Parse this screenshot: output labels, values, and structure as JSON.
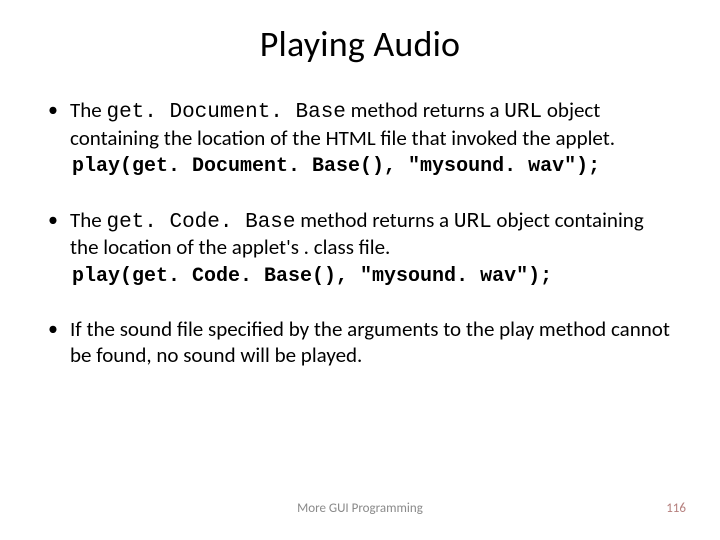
{
  "title": "Playing Audio",
  "bullets": [
    {
      "pre": "The ",
      "code1": "get. Document. Base",
      "mid1": " method returns a ",
      "code2": "URL",
      "post": " object containing the location of the HTML file that invoked the applet.",
      "codeline": "play(get. Document. Base(), \"mysound. wav\");"
    },
    {
      "pre": "The ",
      "code1": "get. Code. Base",
      "mid1": " method returns a ",
      "code2": "URL",
      "post": " object containing the location of the applet's . class file.",
      "codeline": "play(get. Code. Base(), \"mysound. wav\");"
    },
    {
      "pre": "",
      "code1": "",
      "mid1": "",
      "code2": "",
      "post": "If the sound file specified by the arguments to the play method cannot be found, no sound will be played.",
      "codeline": ""
    }
  ],
  "footer_center": "More GUI Programming",
  "footer_right": "116"
}
